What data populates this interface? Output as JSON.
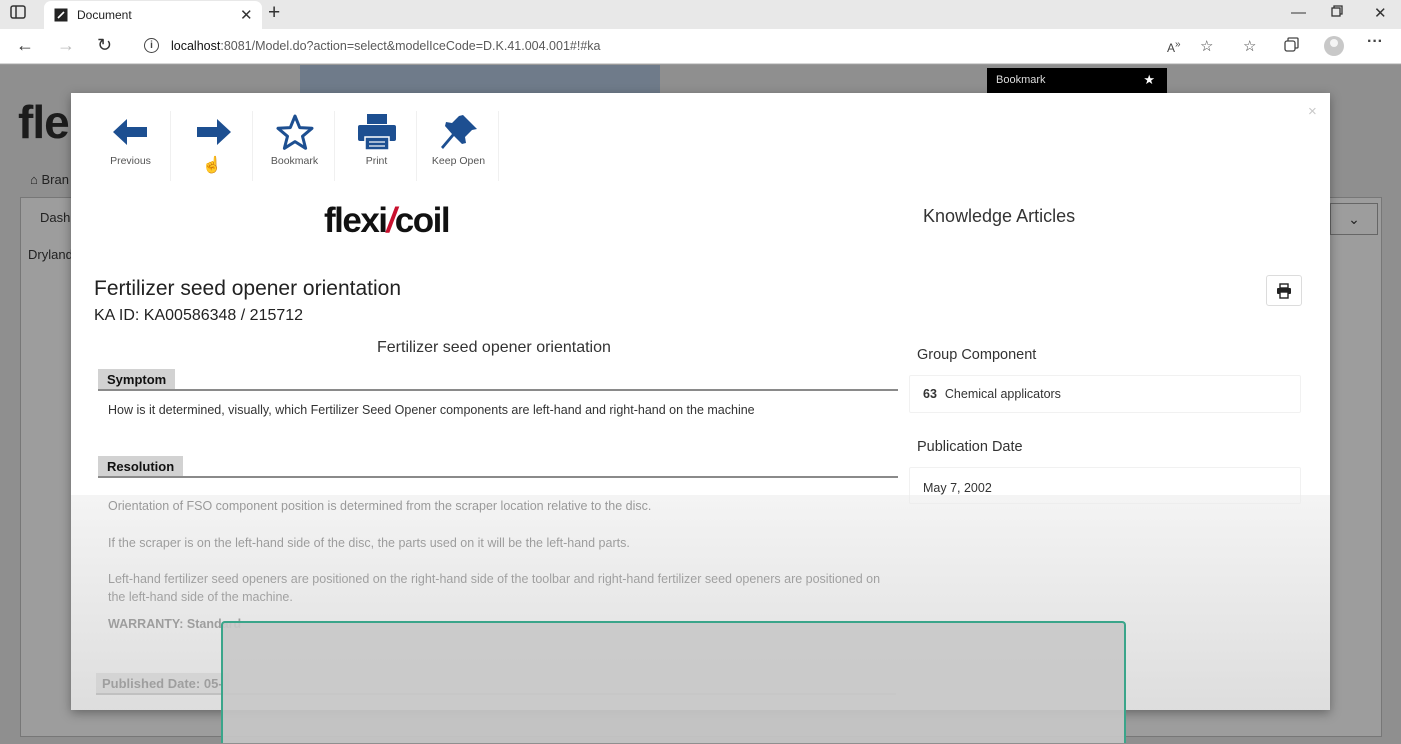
{
  "browser": {
    "tab_title": "Document",
    "url_host": "localhost",
    "url_rest": ":8081/Model.do?action=select&modelIceCode=D.K.41.004.001#!#ka",
    "icons": [
      "sidebar-icon",
      "favicon-icon",
      "close-icon",
      "new-tab-icon",
      "minimize-icon",
      "maximize-icon",
      "close-window-icon",
      "back-icon",
      "forward-icon",
      "refresh-icon",
      "info-icon",
      "read-aloud-icon",
      "favorite-icon",
      "favorites-list-icon",
      "collections-icon",
      "profile-icon",
      "more-icon"
    ]
  },
  "background": {
    "logo": "fle",
    "crumb": "Bran",
    "dash": "Dash",
    "dryland": "Dryland",
    "bookmark_label": "Bookmark"
  },
  "modal": {
    "toolbar": {
      "previous": "Previous",
      "next": "Next",
      "bookmark": "Bookmark",
      "print": "Print",
      "keep_open": "Keep Open"
    },
    "brand": {
      "left": "flexi",
      "right": "coil"
    },
    "ka_heading": "Knowledge Articles",
    "article_title": "Fertilizer seed opener orientation",
    "ka_id": "KA ID: KA00586348 / 215712",
    "sub_title": "Fertilizer seed opener orientation",
    "symptom": {
      "label": "Symptom",
      "text": "How is it determined, visually, which Fertilizer Seed Opener components are left-hand and right-hand on the machine"
    },
    "resolution": {
      "label": "Resolution",
      "p1": "Orientation of FSO component position is determined from the scraper location relative to the disc.",
      "p2": "If the scraper is on the left-hand side of the disc, the parts used on it will be the left-hand parts.",
      "p3": "Left-hand fertilizer seed openers are positioned on the right-hand side of the toolbar and right-hand fertilizer seed openers are positioned on the left-hand side of the machine.",
      "warranty": "WARRANTY: Standard"
    },
    "published_date_label": "Published Date: 05-",
    "group_component": {
      "label": "Group Component",
      "code": "63",
      "value": "Chemical applicators"
    },
    "publication_date": {
      "label": "Publication Date",
      "value": "May 7, 2002"
    },
    "close_symbol": "×"
  }
}
